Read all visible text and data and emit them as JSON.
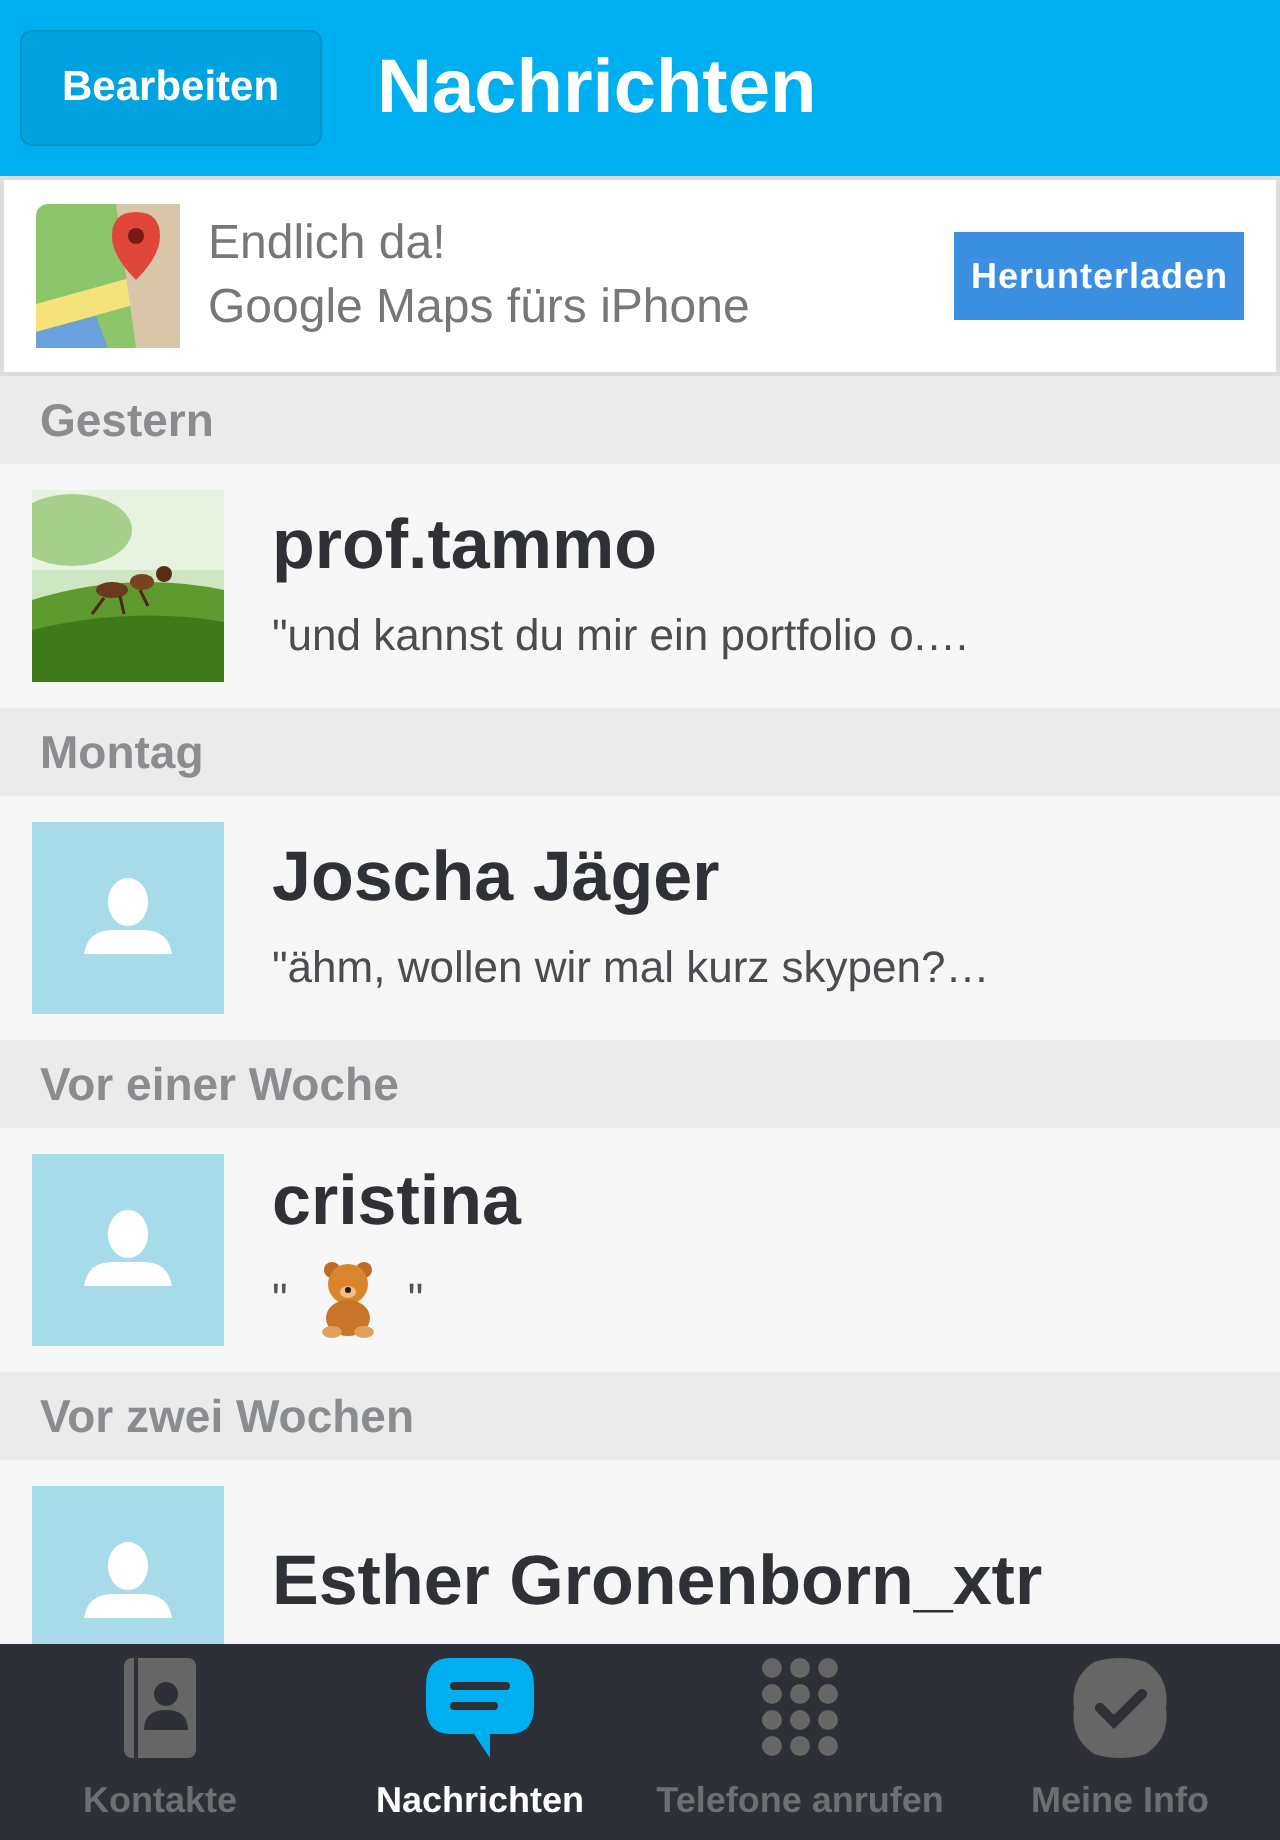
{
  "header": {
    "edit_button": "Bearbeiten",
    "title": "Nachrichten"
  },
  "ad": {
    "line1": "Endlich da!",
    "line2": "Google Maps fürs iPhone",
    "button": "Herunterladen"
  },
  "sections": [
    {
      "label": "Gestern",
      "conversations": [
        {
          "name": "prof.tammo",
          "kind": "text",
          "preview": "\"und kannst du mir ein portfolio o.…"
        }
      ]
    },
    {
      "label": "Montag",
      "conversations": [
        {
          "name": "Joscha Jäger",
          "avatar": {
            "kind": "placeholder"
          },
          "kind": "text",
          "preview": "\"ähm, wollen wir mal kurz skypen?…"
        }
      ]
    },
    {
      "label": "Vor einer Woche",
      "conversations": [
        {
          "name": "cristina",
          "avatar": {
            "kind": "placeholder"
          },
          "kind": "sticker",
          "quote_open": "\"",
          "quote_close": "\""
        }
      ]
    },
    {
      "label": "Vor zwei Wochen",
      "conversations": [
        {
          "name": "Esther Gronenborn_xtr",
          "avatar": {
            "kind": "placeholder"
          },
          "kind": "text"
        }
      ]
    }
  ],
  "tabs": [
    {
      "label": "Kontakte",
      "selected": false
    },
    {
      "label": "Nachrichten",
      "selected": true
    },
    {
      "label": "Telefone anrufen",
      "selected": false
    },
    {
      "label": "Meine Info",
      "selected": false
    }
  ]
}
